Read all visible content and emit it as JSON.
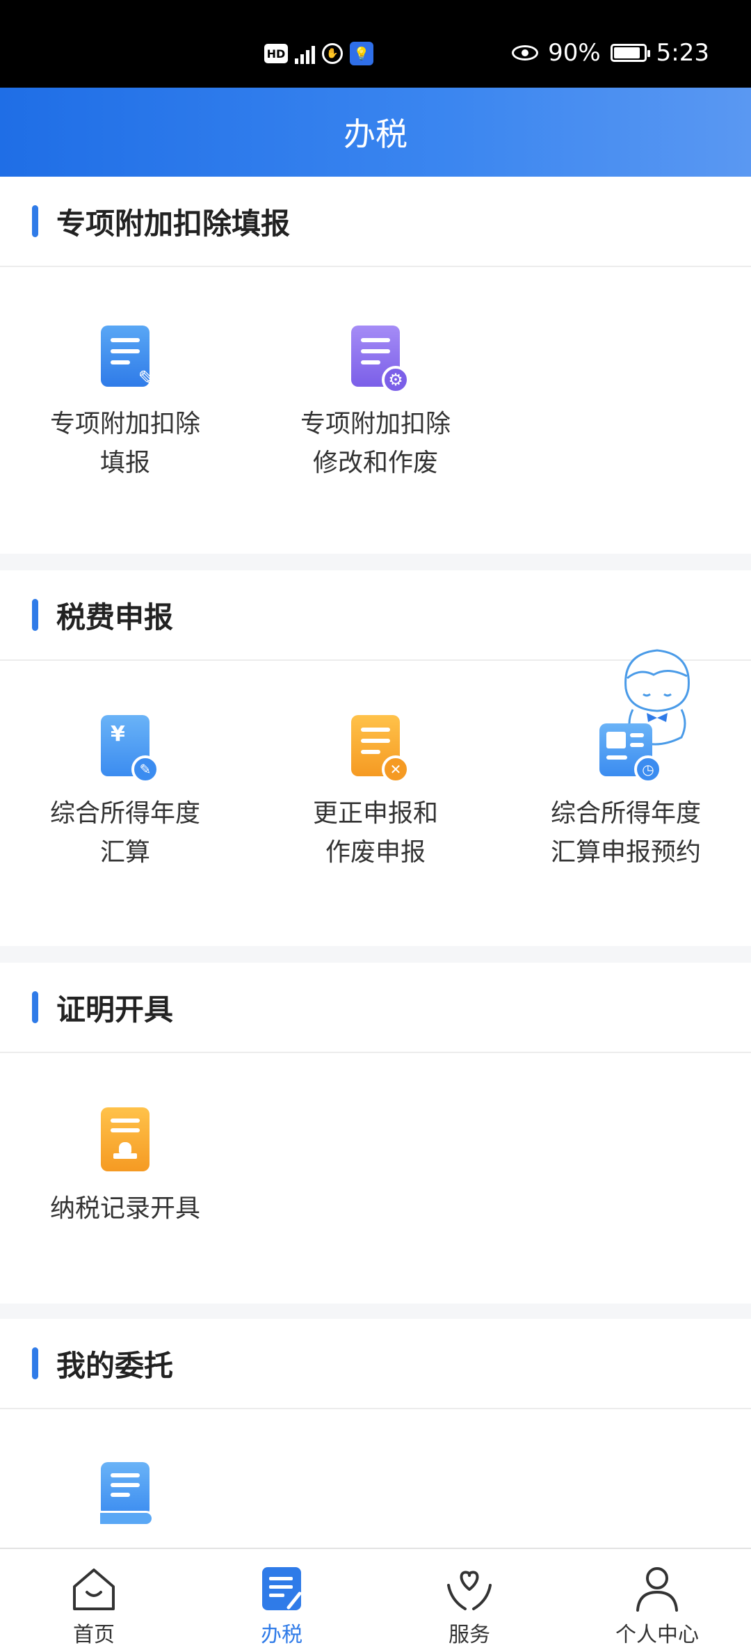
{
  "status_bar": {
    "hd": "HD",
    "network": "4G",
    "battery_percent": "90%",
    "battery_level": 0.9,
    "time": "5:23"
  },
  "header": {
    "title": "办税"
  },
  "sections": [
    {
      "title": "专项附加扣除填报",
      "items": [
        {
          "label": "专项附加扣除\n填报",
          "icon": "document-edit-icon"
        },
        {
          "label": "专项附加扣除\n修改和作废",
          "icon": "document-settings-icon"
        }
      ]
    },
    {
      "title": "税费申报",
      "items": [
        {
          "label": "综合所得年度\n汇算",
          "icon": "yuan-document-icon"
        },
        {
          "label": "更正申报和\n作废申报",
          "icon": "document-cancel-icon"
        },
        {
          "label": "综合所得年度\n汇算申报预约",
          "icon": "calendar-clock-icon"
        }
      ]
    },
    {
      "title": "证明开具",
      "items": [
        {
          "label": "纳税记录开具",
          "icon": "document-stamp-icon"
        }
      ]
    },
    {
      "title": "我的委托",
      "items": [
        {
          "label": "",
          "icon": "document-hand-icon"
        }
      ]
    }
  ],
  "tabbar": [
    {
      "label": "首页",
      "icon": "home-icon",
      "active": false
    },
    {
      "label": "办税",
      "icon": "tax-document-icon",
      "active": true
    },
    {
      "label": "服务",
      "icon": "heart-hands-icon",
      "active": false
    },
    {
      "label": "个人中心",
      "icon": "person-icon",
      "active": false
    }
  ],
  "colors": {
    "primary": "#2f7be8",
    "header_start": "#1f6ee6",
    "header_end": "#5a98f2",
    "orange": "#f5a623",
    "purple": "#8a6cf0"
  }
}
